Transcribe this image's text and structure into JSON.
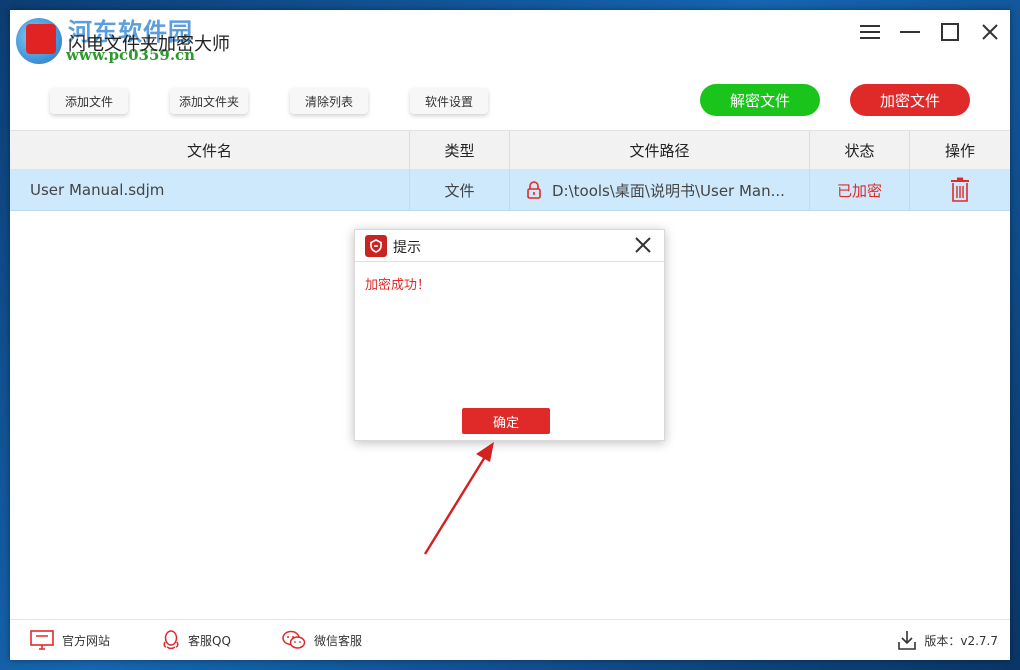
{
  "app": {
    "title": "闪电文件夹加密大师",
    "watermark": "河东软件园",
    "watermark_url": "www.pc0359.cn"
  },
  "toolbar": {
    "add_file": "添加文件",
    "add_folder": "添加文件夹",
    "clear_list": "清除列表",
    "settings": "软件设置",
    "decrypt": "解密文件",
    "encrypt": "加密文件"
  },
  "table": {
    "headers": {
      "name": "文件名",
      "type": "类型",
      "path": "文件路径",
      "status": "状态",
      "op": "操作"
    },
    "rows": [
      {
        "name": "User Manual.sdjm",
        "type": "文件",
        "path": "D:\\tools\\桌面\\说明书\\User Man...",
        "status": "已加密"
      }
    ]
  },
  "dialog": {
    "title": "提示",
    "message": "加密成功！",
    "ok": "确定"
  },
  "footer": {
    "site": "官方网站",
    "qq": "客服QQ",
    "wechat": "微信客服",
    "version": "版本：v2.7.7"
  },
  "colors": {
    "accent_red": "#e02a2a",
    "accent_green": "#1bc41b",
    "row_selected": "#cde9fb"
  }
}
